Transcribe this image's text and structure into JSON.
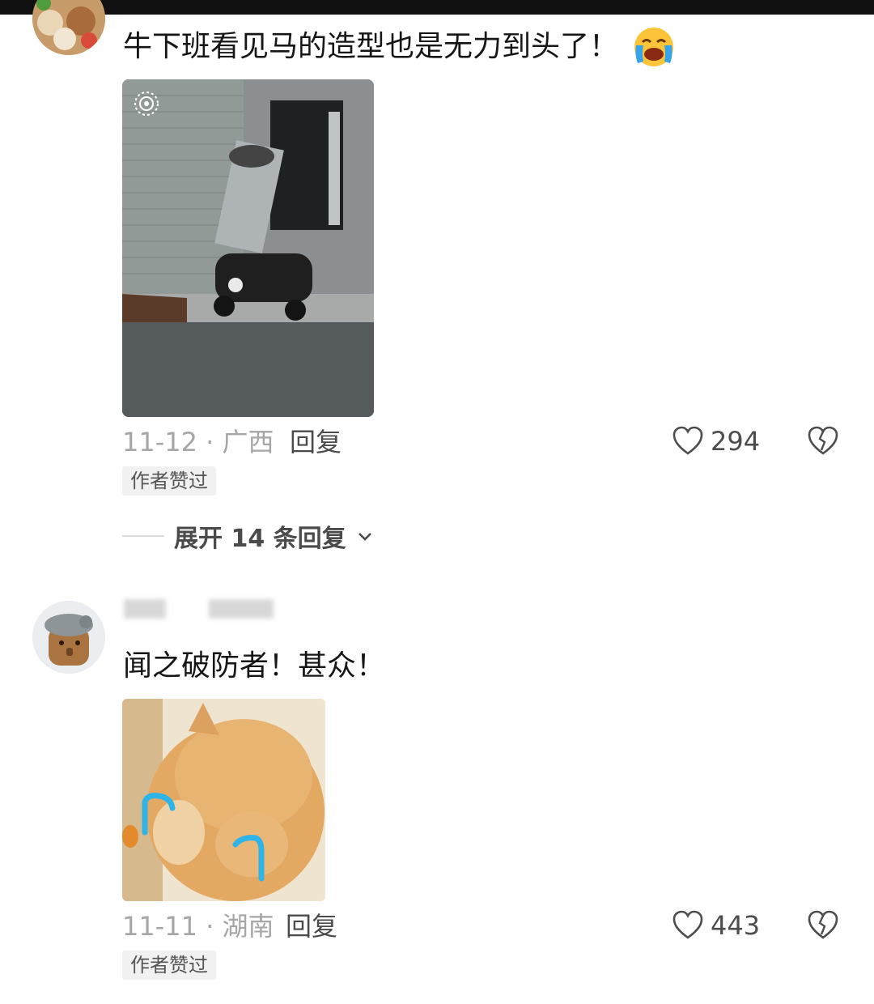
{
  "comments": [
    {
      "text": "牛下班看见马的造型也是无力到头了！",
      "emoji": "loudly-crying-face",
      "date_location": "11-12 · 广西",
      "reply_label": "回复",
      "likes": "294",
      "author_liked_badge": "作者赞过",
      "expand_replies": "展开 14 条回复"
    },
    {
      "text": "闻之破防者！甚众！",
      "date_location": "11-11 · 湖南",
      "reply_label": "回复",
      "likes": "443",
      "author_liked_badge": "作者赞过"
    }
  ],
  "colors": {
    "meta_text": "#a6a6a6",
    "badge_bg": "#f1f1f1",
    "accent_blue": "#2fb4e8"
  }
}
